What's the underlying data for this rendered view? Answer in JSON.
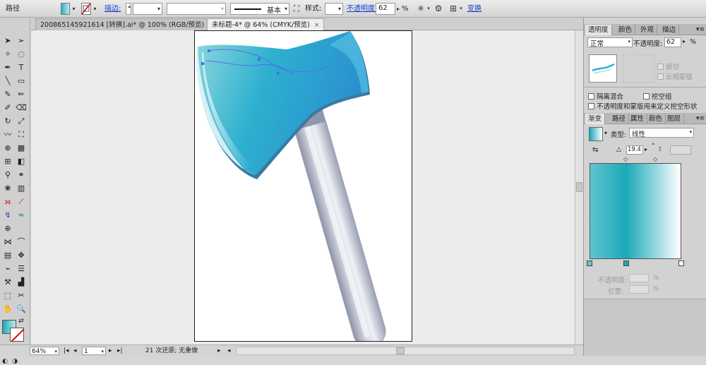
{
  "control_bar": {
    "object_type": "路径",
    "stroke_label": "描边:",
    "stroke_profile": "基本",
    "style_label": "样式:",
    "opacity_label": "不透明度:",
    "opacity_value": "62",
    "percent": "%",
    "transform_link": "变换"
  },
  "tabs": [
    {
      "label": "200865145921614 [转换].ai* @ 100% (RGB/预览)",
      "close": "×"
    },
    {
      "label": "未标题-4* @ 64% (CMYK/预览)",
      "close": "×"
    }
  ],
  "status": {
    "zoom": "64%",
    "page": "1",
    "history": "21 次还原; 无重做"
  },
  "transparency_panel": {
    "tabs": [
      "透明度",
      "颜色",
      "外观",
      "描边"
    ],
    "blend_mode": "正常",
    "opacity_label": "不透明度:",
    "opacity_value": "62",
    "percent": "%",
    "clip": "剪切",
    "invert_mask": "反相蒙版",
    "isolate_blending": "隔离混合",
    "knockout_group": "挖空组",
    "opacity_mask_define": "不透明度和蒙版用来定义挖空形状"
  },
  "gradient_panel": {
    "tabs": [
      "渐变",
      "路径",
      "属性",
      "颜色",
      "图层"
    ],
    "type_label": "类型:",
    "type_value": "线性",
    "angle_value": "19.4",
    "degree": "°",
    "stop_opacity_label": "不透明度:",
    "location_label": "位置:",
    "percent": "%",
    "stops": [
      "#5fc4cf",
      "#1aa9b8",
      "#ffffff"
    ]
  },
  "colors": {
    "accent": "#1a3fc8",
    "axe_blue": "#2a9fd0",
    "handle_gray": "#b9bdc9"
  }
}
